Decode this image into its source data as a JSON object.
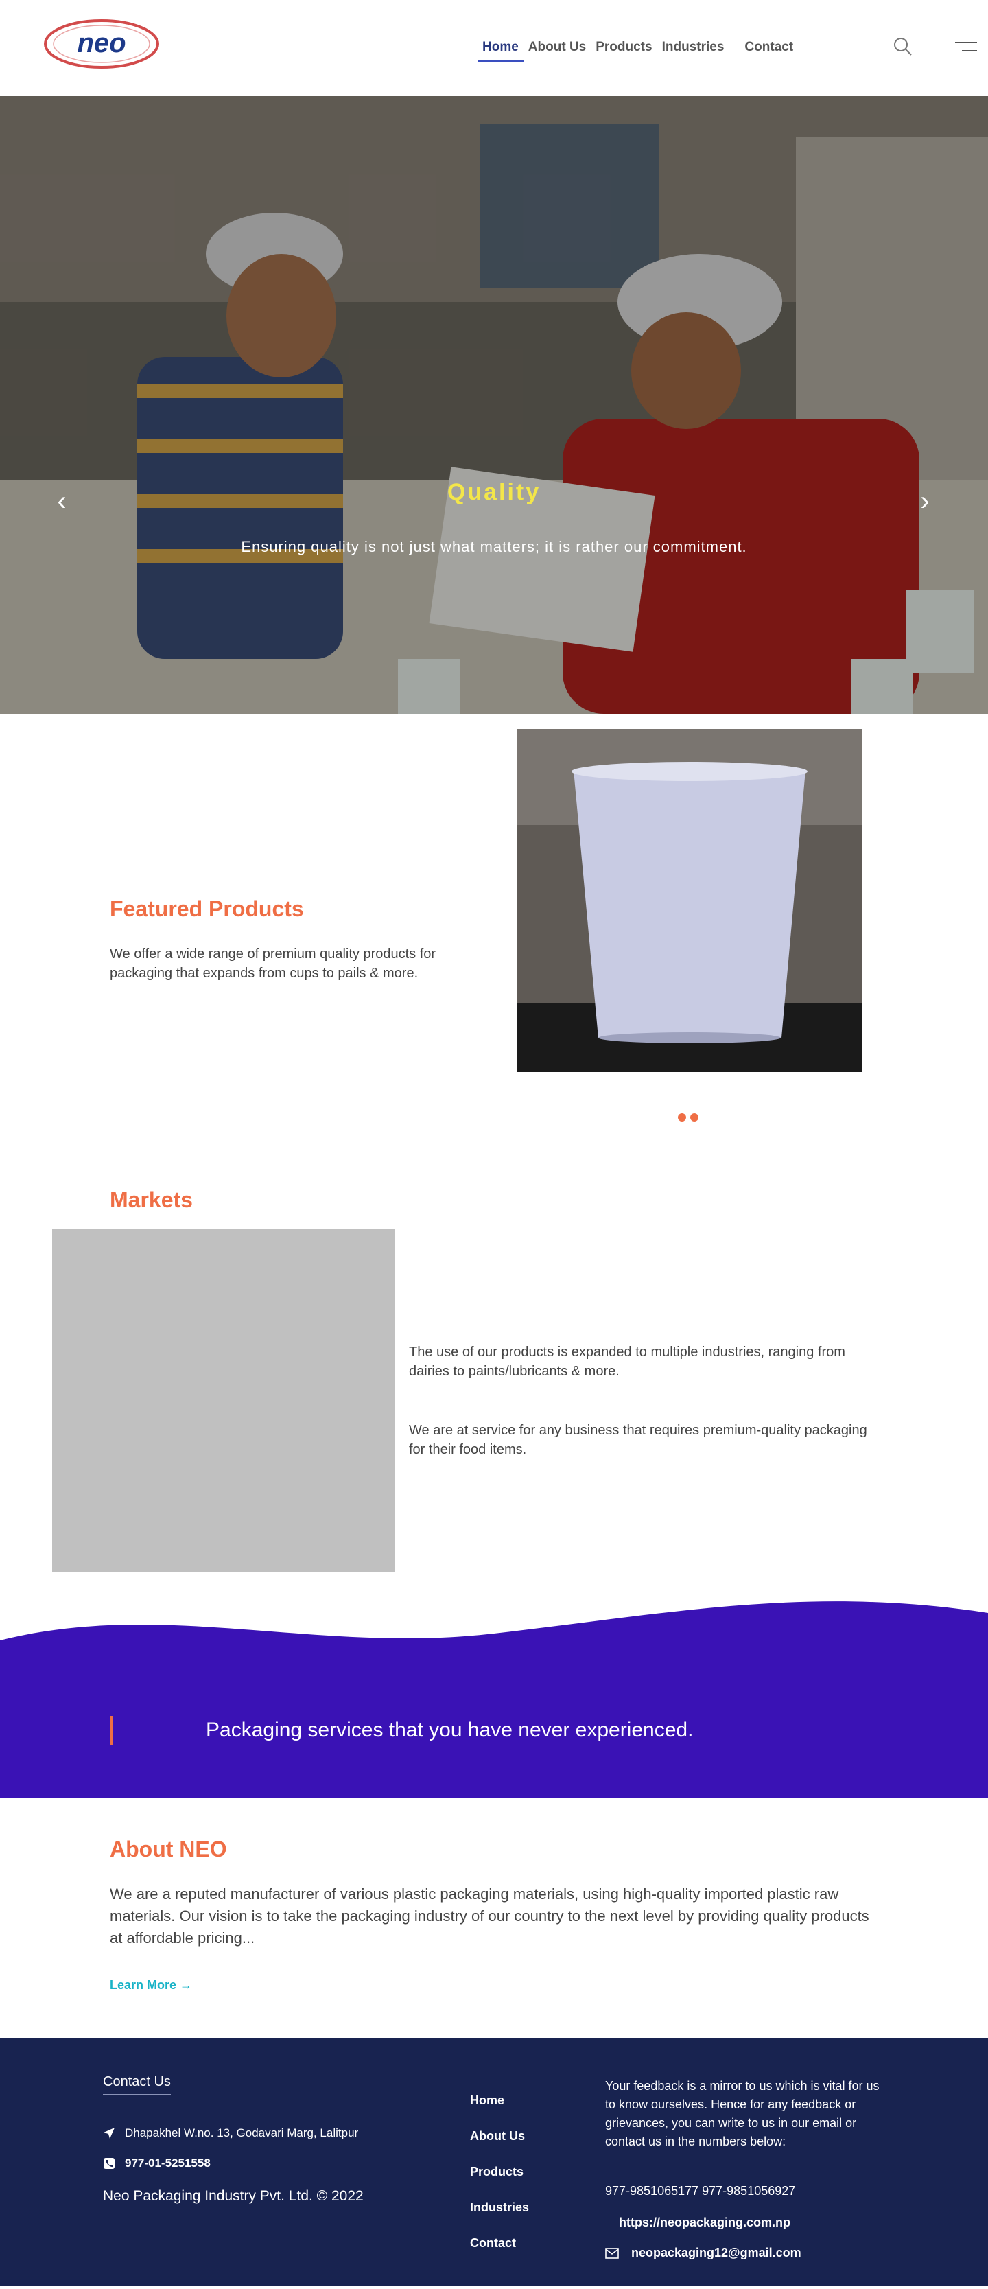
{
  "brand": {
    "logo_text": "neo",
    "logo_color": "#1d3a8a",
    "ring_color": "#d24b4b"
  },
  "nav": {
    "items": [
      {
        "label": "Home",
        "active": true
      },
      {
        "label": "About Us"
      },
      {
        "label": "Products"
      },
      {
        "label": "Industries"
      },
      {
        "label": "Contact"
      }
    ]
  },
  "header_icons": [
    "search-icon",
    "menu-icon"
  ],
  "hero": {
    "title": "Quality",
    "subtitle": "Ensuring quality is not just what matters; it is rather our commitment.",
    "title_color": "#f3e64a",
    "prev_icon": "chevron-left-icon",
    "next_icon": "chevron-right-icon"
  },
  "featured": {
    "title": "Featured Products",
    "text": "We offer a wide range of premium quality products for packaging that expands from cups to pails & more.",
    "accent": "#ef6e45"
  },
  "markets": {
    "title": "Markets",
    "p1": "The use of our products is expanded to multiple industries, ranging from dairies to paints/lubricants & more.",
    "p2": "We are at service for any business that requires premium-quality packaging for their food items."
  },
  "band": {
    "text": "Packaging services that you have never experienced.",
    "color": "#3a12b5"
  },
  "about": {
    "title": "About NEO",
    "text": "We are a reputed manufacturer of various plastic packaging materials, using high-quality imported plastic raw materials. Our vision is to take the packaging industry of our country to the next level by providing quality products at affordable pricing...",
    "link": "Learn More",
    "link_color": "#19b3c7"
  },
  "footer": {
    "contact_title": "Contact Us",
    "address": "Dhapakhel W.no. 13, Godavari Marg, Lalitpur",
    "phone": "977-01-5251558",
    "copyright": "Neo Packaging Industry Pvt. Ltd. © 2022",
    "links": [
      "Home",
      "About Us",
      "Products",
      "Industries",
      "Contact"
    ],
    "feedback": "Your feedback is a mirror to us which is vital for us to know ourselves. Hence for any feedback or grievances, you can write to us in our email or contact us in the numbers below:",
    "mobiles": "977-9851065177 977-9851056927",
    "website": "https://neopackaging.com.np",
    "email": "neopackaging12@gmail.com",
    "bg": "#182350"
  }
}
